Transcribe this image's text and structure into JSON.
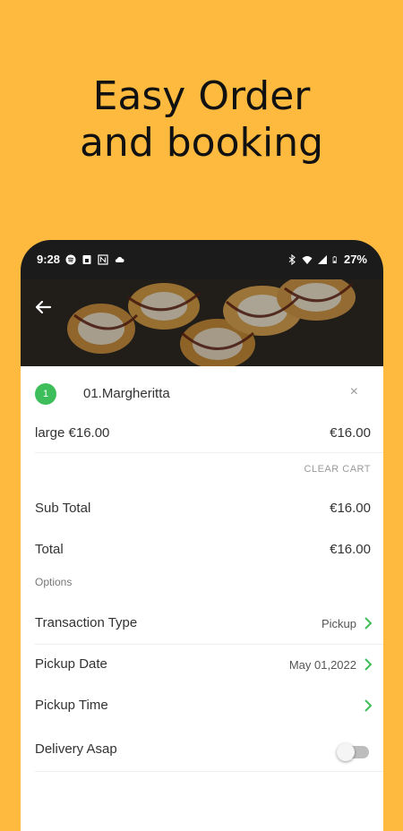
{
  "headline": {
    "line1": "Easy Order",
    "line2": "and booking"
  },
  "status_bar": {
    "time": "9:28",
    "battery": "27%"
  },
  "cart": {
    "item_qty": "1",
    "item_name": "01.Margheritta",
    "remove_symbol": "×",
    "item_size_price": "large €16.00",
    "item_total": "€16.00",
    "clear_cart": "CLEAR CART"
  },
  "totals": {
    "subtotal_label": "Sub Total",
    "subtotal_value": "€16.00",
    "total_label": "Total",
    "total_value": "€16.00"
  },
  "options": {
    "heading": "Options",
    "transaction_label": "Transaction Type",
    "transaction_value": "Pickup",
    "pickup_date_label": "Pickup Date",
    "pickup_date_value": "May 01,2022",
    "pickup_time_label": "Pickup Time",
    "delivery_asap_label": "Delivery Asap",
    "delivery_asap_on": false
  },
  "colors": {
    "background": "#FDBA3E",
    "accent_green": "#3DBE5A"
  }
}
